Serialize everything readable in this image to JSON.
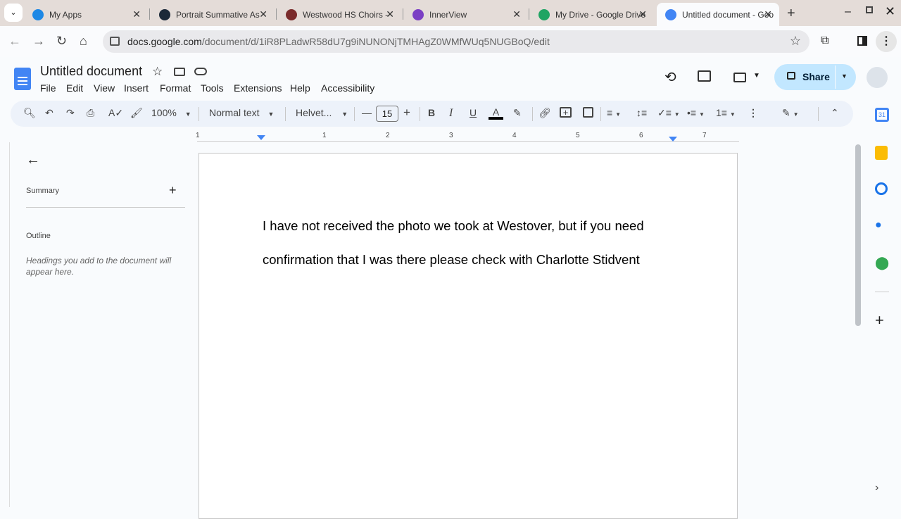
{
  "browser": {
    "tabs": [
      {
        "label": "My Apps",
        "icon": "cloud-icon",
        "color": "#1e88e5"
      },
      {
        "label": "Portrait Summative As",
        "icon": "schoology-icon",
        "color": "#1c2a39"
      },
      {
        "label": "Westwood HS Choirs -",
        "icon": "westwood-icon",
        "color": "#7a2b2b"
      },
      {
        "label": "InnerView",
        "icon": "innerview-icon",
        "color": "#7b3fc4"
      },
      {
        "label": "My Drive - Google Drive",
        "icon": "drive-icon",
        "color": "#1fa463"
      },
      {
        "label": "Untitled document - Google Docs",
        "icon": "docs-icon",
        "color": "#4285f4"
      }
    ],
    "url_host": "docs.google.com",
    "url_path": "/document/d/1iR8PLadwR58dU7g9iNUNONjTMHAgZ0WMfWUq5NUGBoQ/edit"
  },
  "doc": {
    "title": "Untitled document",
    "menus": [
      "File",
      "Edit",
      "View",
      "Insert",
      "Format",
      "Tools",
      "Extensions",
      "Help",
      "Accessibility"
    ],
    "share_label": "Share",
    "zoom": "100%",
    "style": "Normal text",
    "font": "Helvet...",
    "font_size": "15",
    "ruler_numbers": [
      "1",
      "1",
      "2",
      "3",
      "4",
      "5",
      "6",
      "7"
    ],
    "paragraphs": [
      "I have not received the photo we took at Westover, but if you need",
      "confirmation that I was there please check with Charlotte Stidvent"
    ]
  },
  "sidebar": {
    "summary": "Summary",
    "outline": "Outline",
    "placeholder": "Headings you add to the document will appear here."
  },
  "colors": {
    "accent": "#0b57d0",
    "share_bg": "#c2e7ff",
    "toolbar_bg": "#edf2fa"
  }
}
